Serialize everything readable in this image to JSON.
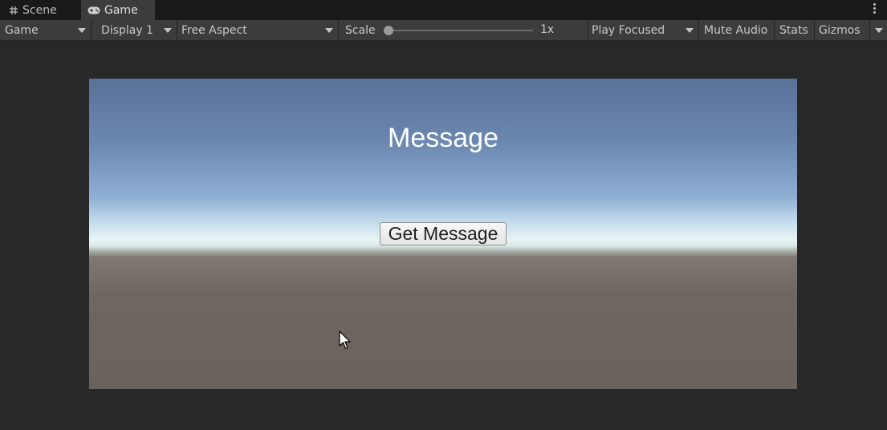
{
  "tabs": [
    {
      "label": "Scene",
      "icon": "grid-icon"
    },
    {
      "label": "Game",
      "icon": "gamepad-icon",
      "active": true
    }
  ],
  "toolbar": {
    "view_mode": "Game",
    "display": "Display 1",
    "aspect": "Free Aspect",
    "scale_label": "Scale",
    "scale_value": "1x",
    "play_mode": "Play Focused",
    "mute_audio": "Mute Audio",
    "stats": "Stats",
    "gizmos": "Gizmos"
  },
  "game": {
    "title": "Message",
    "button_label": "Get Message"
  },
  "colors": {
    "editor_bg": "#282828",
    "toolbar_bg": "#3c3c3c",
    "tabbar_bg": "#191919",
    "sky_top": "#587198",
    "horizon": "#e9f4f3",
    "ground": "#6a625c"
  }
}
